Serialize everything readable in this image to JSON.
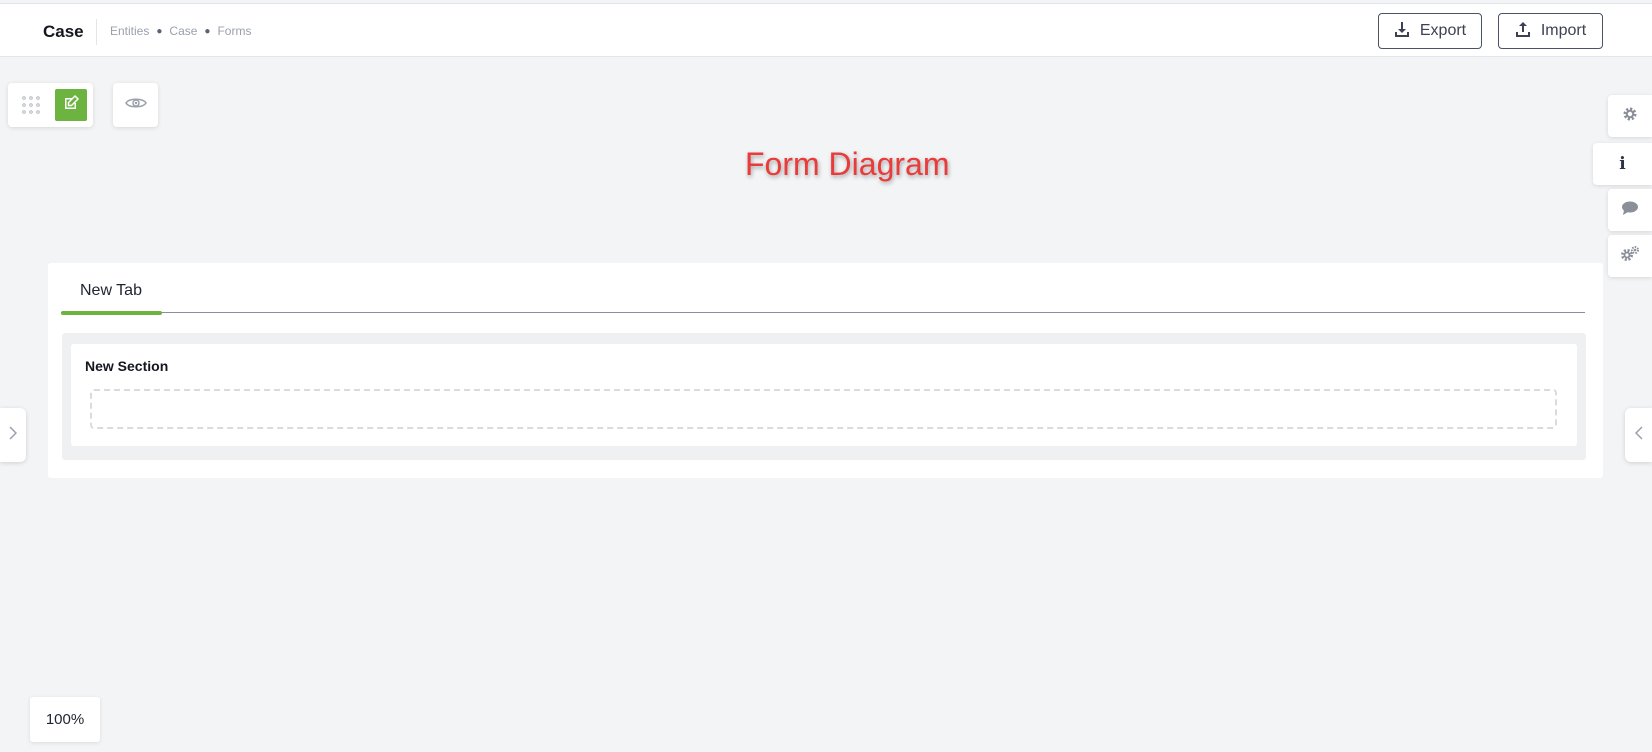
{
  "header": {
    "title": "Case",
    "breadcrumb": [
      "Entities",
      "Case",
      "Forms"
    ],
    "export_label": "Export",
    "import_label": "Import"
  },
  "toolbar": {
    "icons": [
      "drag-grid-icon",
      "edit-icon",
      "eye-icon"
    ],
    "accent_color": "#6cb33f"
  },
  "canvas": {
    "diagram_title": "Form Diagram",
    "title_color": "#ea3b3b"
  },
  "right_panel": {
    "icons": [
      "gear-icon",
      "info-icon",
      "comment-icon",
      "gears-icon"
    ]
  },
  "form": {
    "tab_label": "New Tab",
    "section_title": "New Section"
  },
  "zoom": {
    "level": "100%"
  }
}
